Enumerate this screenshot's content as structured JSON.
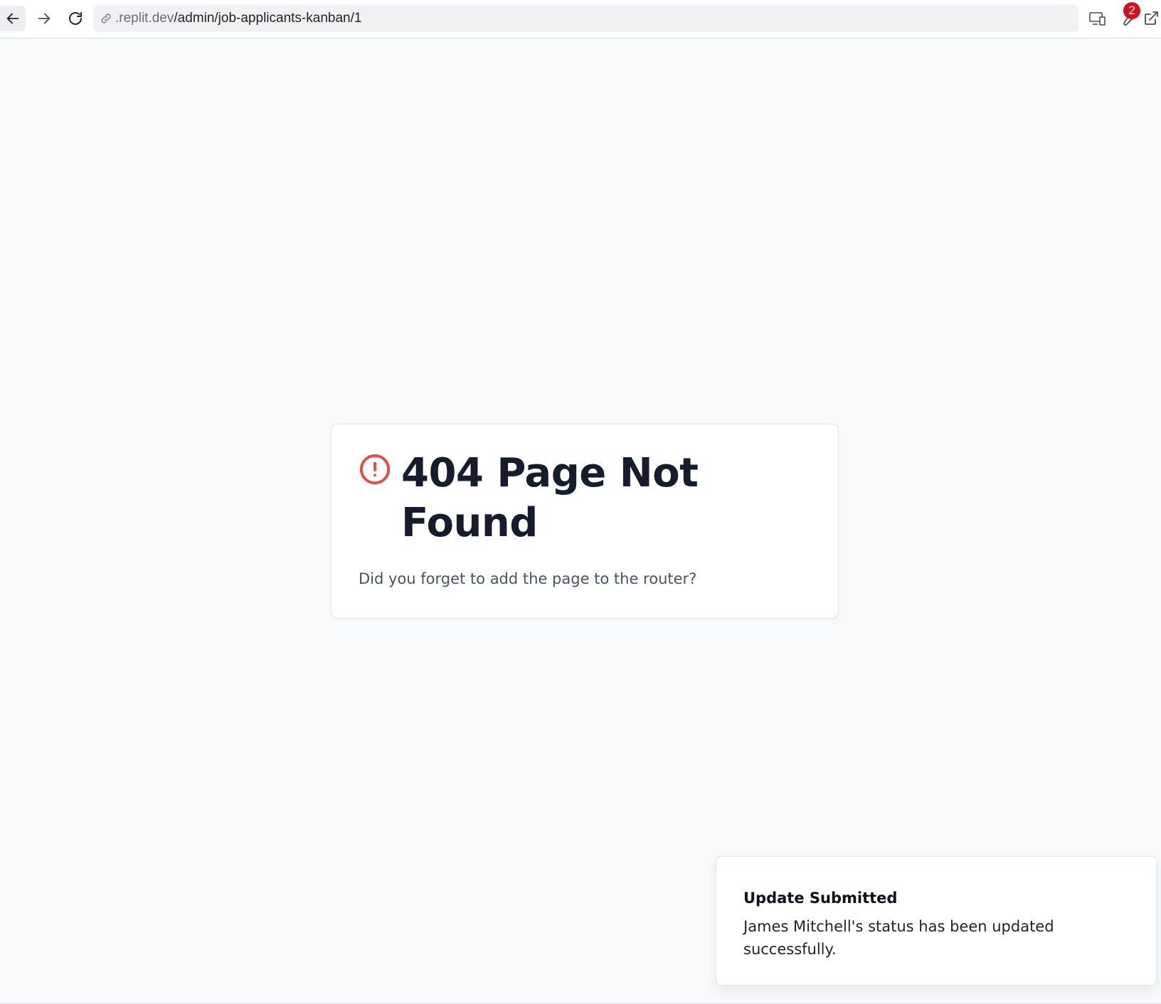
{
  "browser": {
    "url_domain": ".replit.dev",
    "url_path": "/admin/job-applicants-kanban/1",
    "notification_count": "2",
    "icons": {
      "back": "arrow-left-icon",
      "forward": "arrow-right-icon",
      "reload": "reload-icon",
      "link": "link-icon",
      "devices": "devices-icon",
      "wrench": "wrench-icon",
      "external": "open-external-icon"
    }
  },
  "not_found": {
    "title": "404 Page Not Found",
    "message": "Did you forget to add the page to the router?",
    "icon": "alert-circle-icon",
    "icon_color": "#ef4444"
  },
  "toast": {
    "title": "Update Submitted",
    "description": "James Mitchell's status has been updated successfully."
  }
}
